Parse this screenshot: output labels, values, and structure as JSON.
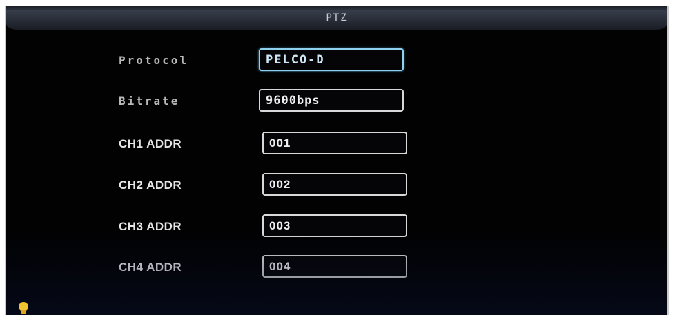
{
  "window": {
    "title": "PTZ"
  },
  "fields": [
    {
      "label": "Protocol",
      "value": "PELCO-D"
    },
    {
      "label": "Bitrate",
      "value": "9600bps"
    },
    {
      "label": "CH1 ADDR",
      "value": "001"
    },
    {
      "label": "CH2 ADDR",
      "value": "002"
    },
    {
      "label": "CH3 ADDR",
      "value": "003"
    },
    {
      "label": "CH4 ADDR",
      "value": "004"
    }
  ],
  "icons": {
    "status": "lightbulb-icon"
  },
  "colors": {
    "background": "#020203",
    "field_border": "#d8d8d8",
    "selected_border": "#8fd0ef",
    "bulb": "#f2c230"
  }
}
